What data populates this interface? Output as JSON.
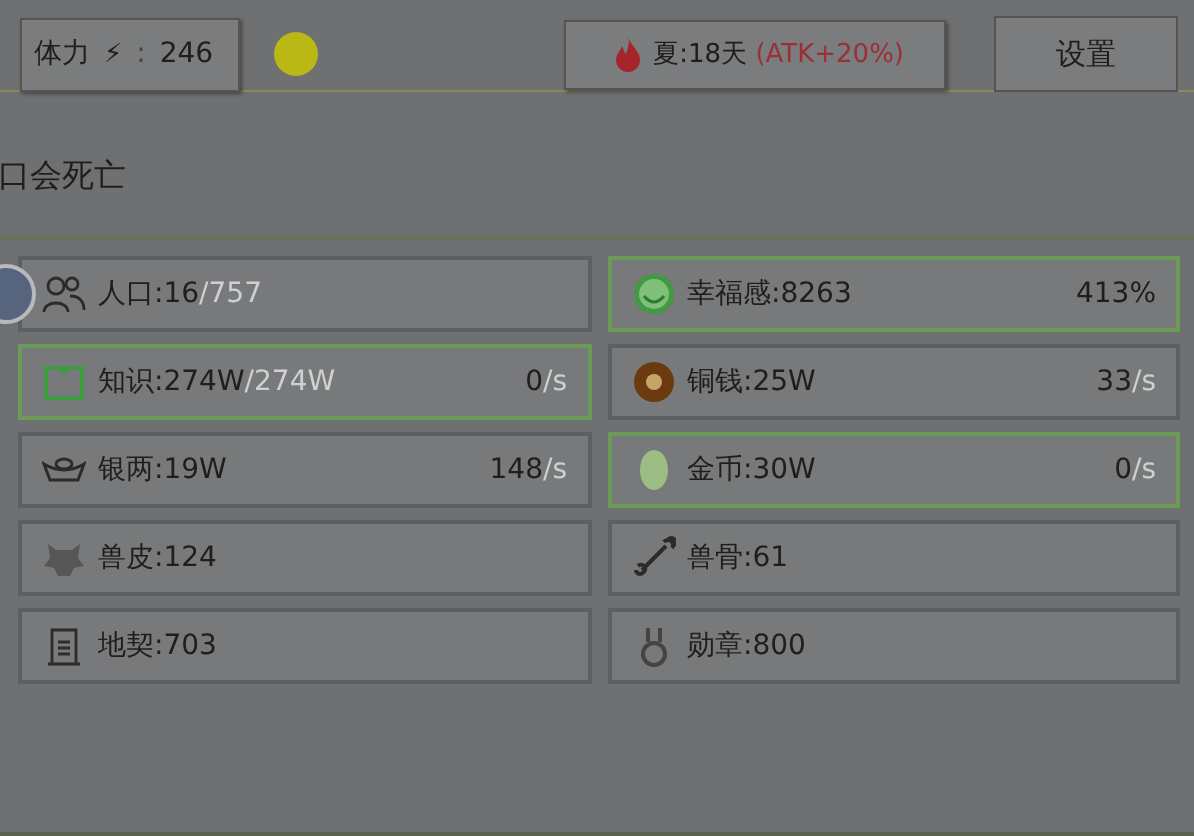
{
  "stamina": {
    "label": "体力",
    "icon_char": "⚡",
    "separator": ":",
    "value": "246"
  },
  "season": {
    "text": "夏:18天",
    "bonus": "(ATK+20%)"
  },
  "settings_button": "设置",
  "message": "口会死亡",
  "resources": [
    {
      "label": "人口:16",
      "total": "/757",
      "highlighted": false
    },
    {
      "label": "幸福感:8263",
      "rate": "413%",
      "highlighted": true
    },
    {
      "label": "知识:274W",
      "total": "/274W",
      "rate": "0",
      "rate_unit": "/s",
      "highlighted": true
    },
    {
      "label": "铜钱:25W",
      "rate": "33",
      "rate_unit": "/s",
      "highlighted": false
    },
    {
      "label": "银两:19W",
      "rate": "148",
      "rate_unit": "/s",
      "highlighted": false
    },
    {
      "label": "金币:30W",
      "rate": "0",
      "rate_unit": "/s",
      "highlighted": true
    },
    {
      "label": "兽皮:124",
      "highlighted": false
    },
    {
      "label": "兽骨:61",
      "highlighted": false
    },
    {
      "label": "地契:703",
      "highlighted": false
    },
    {
      "label": "勋章:800",
      "highlighted": false
    }
  ]
}
